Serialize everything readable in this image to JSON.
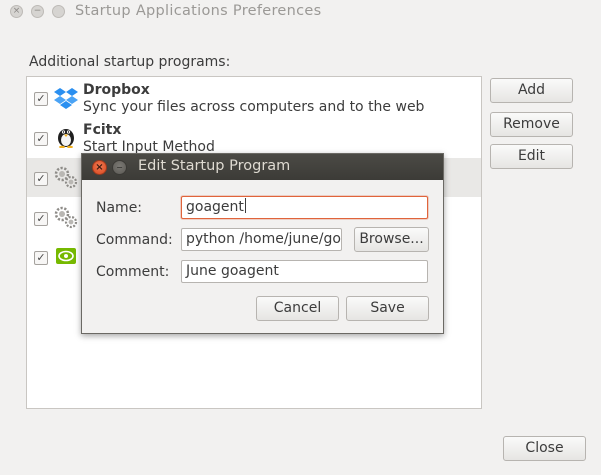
{
  "window": {
    "title": "Startup Applications Preferences",
    "close_glyph": "×",
    "minimize_glyph": "−"
  },
  "main": {
    "section_label": "Additional startup programs:",
    "programs": [
      {
        "name": "Dropbox",
        "description": "Sync your files across computers and to the web",
        "checked": true,
        "icon": "dropbox-icon"
      },
      {
        "name": "Fcitx",
        "description": "Start Input Method",
        "checked": true,
        "icon": "penguin-icon"
      },
      {
        "name": "",
        "description": "",
        "checked": true,
        "icon": "gears-icon",
        "selected": true
      },
      {
        "name": "",
        "description": "",
        "checked": true,
        "icon": "gears-icon"
      },
      {
        "name": "",
        "description": "",
        "checked": true,
        "icon": "nvidia-icon"
      }
    ],
    "checkmark": "✓",
    "buttons": {
      "add": "Add",
      "remove": "Remove",
      "edit": "Edit",
      "close": "Close"
    }
  },
  "dialog": {
    "title": "Edit Startup Program",
    "close_glyph": "×",
    "minimize_glyph": "−",
    "name_label": "Name:",
    "name_value": "goagent",
    "command_label": "Command:",
    "command_value": "python /home/june/go",
    "browse_label": "Browse...",
    "comment_label": "Comment:",
    "comment_value": "June goagent",
    "cancel_label": "Cancel",
    "save_label": "Save"
  },
  "colors": {
    "accent_focus": "#e0643b",
    "dialog_titlebar": "#3c3b37",
    "close_button": "#d8471f"
  }
}
